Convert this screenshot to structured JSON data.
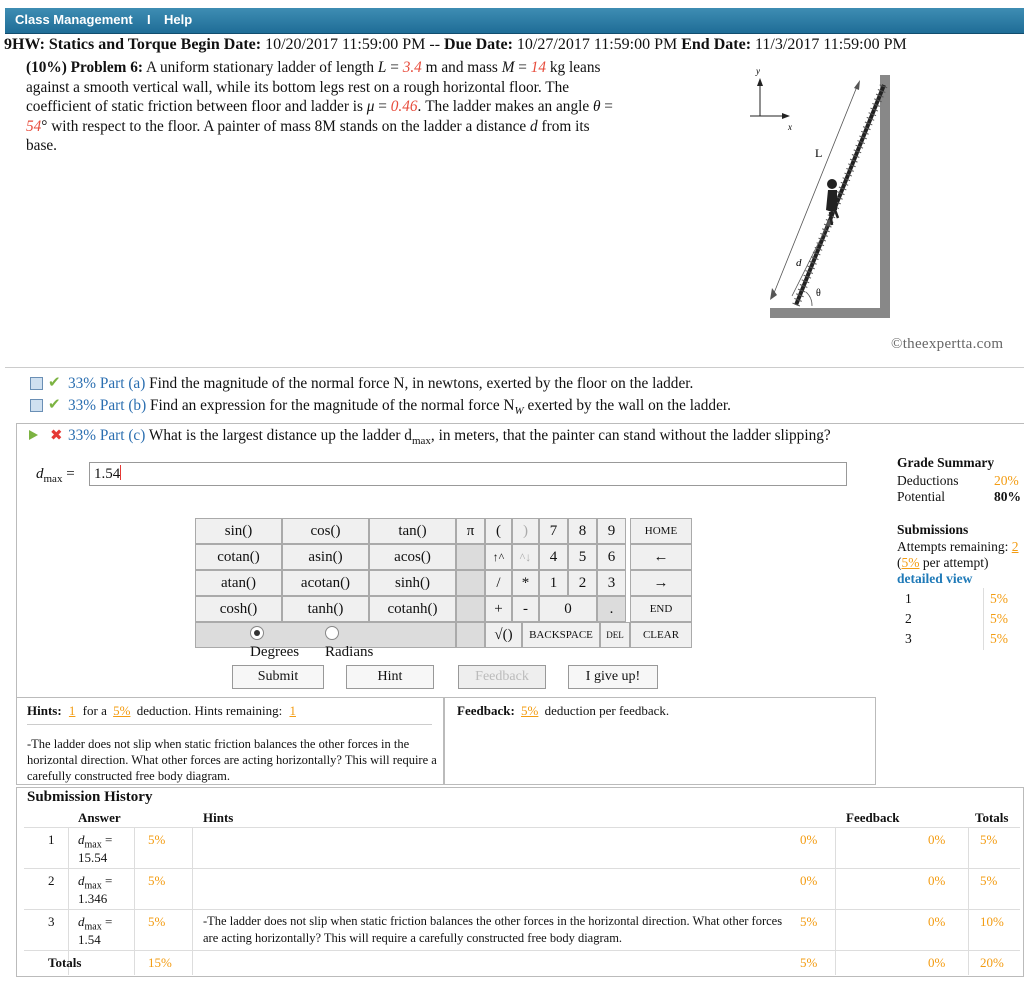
{
  "menu": {
    "class_management": "Class Management",
    "sep": "I",
    "help": "Help"
  },
  "hw": {
    "title": "9HW: Statics and Torque",
    "begin_label": "Begin Date:",
    "begin": "10/20/2017 11:59:00 PM --",
    "due_label": "Due Date:",
    "due": "10/27/2017 11:59:00 PM",
    "end_label": "End Date:",
    "end": "11/3/2017 11:59:00 PM"
  },
  "problem": {
    "header": "(10%) Problem 6:",
    "t1": "A uniform stationary ladder of length",
    "L_sym": "L",
    "L_val": "3.4",
    "t2": "m and mass",
    "M_sym": "M",
    "M_val": "14",
    "t3": "kg leans against a smooth vertical wall, while its bottom legs rest on a rough horizontal floor. The coefficient of static friction between floor and ladder is",
    "mu_sym": "μ",
    "mu_val": "0.46",
    "t4": ". The ladder makes an angle",
    "theta_sym": "θ",
    "theta_val": "54",
    "t5": "° with respect to the floor. A painter of mass",
    "t6": "8M",
    "t7": "stands on the ladder a distance",
    "d_sym": "d",
    "t8": "from its base."
  },
  "figure": {
    "y": "y",
    "x": "x",
    "L": "L",
    "d": "d",
    "theta": "θ",
    "credit": "©theexpertta.com"
  },
  "parts": {
    "a": {
      "pct": "33% Part (a)",
      "text": "Find the magnitude of the normal force N, in newtons, exerted by the floor on the ladder."
    },
    "b": {
      "pct": "33% Part (b)",
      "text": "Find an expression for the magnitude of the normal force N",
      "sub": "W",
      "text2": "exerted by the wall on the ladder."
    },
    "c": {
      "pct": "33% Part (c)",
      "text": "What is the largest distance up the ladder d",
      "sub": "max",
      "text2": ", in meters, that the painter can stand without the ladder slipping?"
    }
  },
  "answer": {
    "label": "d",
    "sub": "max",
    "eq": "=",
    "value": "1.54"
  },
  "keypad": {
    "fn": [
      [
        "sin()",
        "cos()",
        "tan()"
      ],
      [
        "cotan()",
        "asin()",
        "acos()"
      ],
      [
        "atan()",
        "acotan()",
        "sinh()"
      ],
      [
        "cosh()",
        "tanh()",
        "cotanh()"
      ]
    ],
    "degrees": "Degrees",
    "radians": "Radians",
    "pi": "π",
    "lpar": "(",
    "rpar": ")",
    "up": "↑^",
    "down": "^↓",
    "slash": "/",
    "star": "*",
    "plus": "+",
    "minus": "-",
    "sqrt": "√()",
    "digits": [
      "7",
      "8",
      "9",
      "4",
      "5",
      "6",
      "1",
      "2",
      "3",
      "0",
      "."
    ],
    "home": "HOME",
    "left": "←",
    "right": "→",
    "end": "END",
    "backspace": "BACKSPACE",
    "del": "DEL",
    "clear": "CLEAR"
  },
  "buttons": {
    "submit": "Submit",
    "hint": "Hint",
    "feedback": "Feedback",
    "giveup": "I give up!"
  },
  "grade": {
    "title": "Grade Summary",
    "deductions_label": "Deductions",
    "deductions": "20%",
    "potential_label": "Potential",
    "potential": "80%",
    "submissions_title": "Submissions",
    "attempts_label": "Attempts remaining:",
    "attempts": "2",
    "per_attempt_pct": "5%",
    "per_attempt_label": "per attempt)",
    "detailed": "detailed view",
    "rows": [
      {
        "n": "1",
        "v": "5%"
      },
      {
        "n": "2",
        "v": "5%"
      },
      {
        "n": "3",
        "v": "5%"
      }
    ]
  },
  "hints": {
    "label": "Hints:",
    "count": "1",
    "for_a": "for a",
    "pct": "5%",
    "ded": "deduction. Hints remaining:",
    "remaining": "1",
    "text": "-The ladder does not slip when static friction balances the other forces in the horizontal direction. What other forces are acting horizontally? This will require a carefully constructed free body diagram."
  },
  "feedback": {
    "label": "Feedback:",
    "pct": "5%",
    "text": "deduction per feedback."
  },
  "history": {
    "title": "Submission History",
    "cols": {
      "answer": "Answer",
      "hints": "Hints",
      "feedback": "Feedback",
      "totals": "Totals"
    },
    "rows": [
      {
        "n": "1",
        "lbl": "d",
        "sub": "max",
        "eq": "=",
        "val": "15.54",
        "pct": "5%",
        "hint": "",
        "hpct": "0%",
        "fpct": "0%",
        "tpct": "5%"
      },
      {
        "n": "2",
        "lbl": "d",
        "sub": "max",
        "eq": "=",
        "val": "1.346",
        "pct": "5%",
        "hint": "",
        "hpct": "0%",
        "fpct": "0%",
        "tpct": "5%"
      },
      {
        "n": "3",
        "lbl": "d",
        "sub": "max",
        "eq": "=",
        "val": "1.54",
        "pct": "5%",
        "hint": "-The ladder does not slip when static friction balances the other forces in the horizontal direction. What other forces are acting horizontally? This will require a carefully constructed free body diagram.",
        "hpct": "5%",
        "fpct": "0%",
        "tpct": "10%"
      }
    ],
    "totals": {
      "label": "Totals",
      "pct": "15%",
      "hpct": "5%",
      "fpct": "0%",
      "tpct": "20%"
    }
  }
}
